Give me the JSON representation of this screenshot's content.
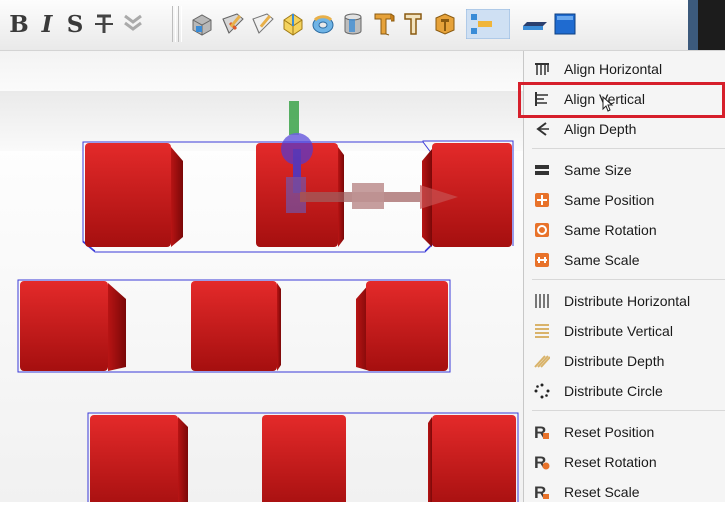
{
  "toolbar": {
    "format_buttons": [
      "B",
      "I",
      "S"
    ],
    "buttons": [
      {
        "name": "strikethrough-icon"
      },
      {
        "name": "expand-chevron-icon"
      },
      {
        "name": "box-icon"
      },
      {
        "name": "wedge-icon"
      },
      {
        "name": "wedge-outline-icon"
      },
      {
        "name": "gem-icon"
      },
      {
        "name": "torus-icon"
      },
      {
        "name": "cylinder-icon"
      },
      {
        "name": "text-3d-icon"
      },
      {
        "name": "text-3d-outline-icon"
      },
      {
        "name": "text-3d-shaded-icon"
      },
      {
        "name": "align-icon"
      },
      {
        "name": "plane-icon"
      },
      {
        "name": "blue-square-icon"
      }
    ],
    "colors": {
      "accent": "#3a8cd7",
      "highlight": "#d61f2b",
      "cube": "#c81e1e",
      "selection": "#3b3bd8"
    }
  },
  "menu": {
    "items": [
      {
        "label": "Align Horizontal",
        "icon": "align-horizontal-icon"
      },
      {
        "label": "Align Vertical",
        "icon": "align-vertical-icon",
        "highlighted": true
      },
      {
        "label": "Align Depth",
        "icon": "align-depth-icon"
      },
      {
        "label": "Same Size",
        "icon": "same-size-icon"
      },
      {
        "label": "Same Position",
        "icon": "same-position-icon"
      },
      {
        "label": "Same Rotation",
        "icon": "same-rotation-icon"
      },
      {
        "label": "Same Scale",
        "icon": "same-scale-icon"
      },
      {
        "label": "Distribute Horizontal",
        "icon": "distribute-horizontal-icon"
      },
      {
        "label": "Distribute Vertical",
        "icon": "distribute-vertical-icon"
      },
      {
        "label": "Distribute Depth",
        "icon": "distribute-depth-icon"
      },
      {
        "label": "Distribute Circle",
        "icon": "distribute-circle-icon"
      },
      {
        "label": "Reset Position",
        "icon": "reset-position-icon"
      },
      {
        "label": "Reset Rotation",
        "icon": "reset-rotation-icon"
      },
      {
        "label": "Reset Scale",
        "icon": "reset-scale-icon"
      }
    ]
  }
}
